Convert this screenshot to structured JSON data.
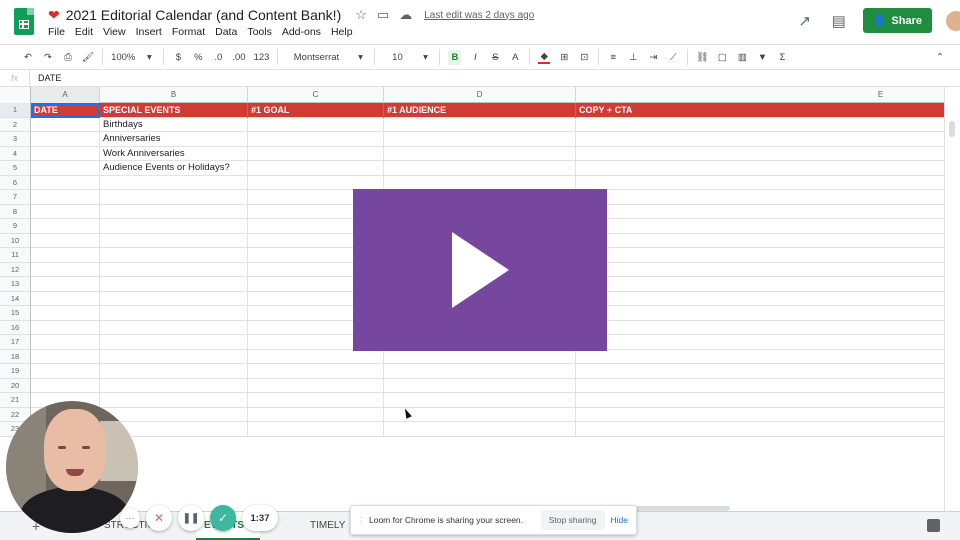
{
  "header": {
    "title": "2021 Editorial Calendar (and Content Bank!)",
    "last_edit": "Last edit was 2 days ago",
    "share_label": "Share",
    "icons": [
      "heart-icon",
      "star-icon",
      "folder-icon",
      "cloud-icon",
      "trend-icon",
      "comment-icon"
    ]
  },
  "menu": {
    "items": [
      "File",
      "Edit",
      "View",
      "Insert",
      "Format",
      "Data",
      "Tools",
      "Add-ons",
      "Help"
    ]
  },
  "toolbar": {
    "zoom": "100%",
    "currency": "$",
    "percent": "%",
    "decrease_decimal": ".0",
    "increase_decimal": ".00",
    "format_more": "123",
    "font": "Montserrat",
    "font_size": "10",
    "bold": "B",
    "italic": "I",
    "strike": "S",
    "text_color": "A"
  },
  "formula": {
    "fx": "fx",
    "value": "DATE"
  },
  "grid": {
    "columns": [
      "A",
      "B",
      "C",
      "D",
      "E"
    ],
    "row_numbers": [
      "1",
      "2",
      "3",
      "4",
      "5",
      "6",
      "7",
      "8",
      "9",
      "10",
      "11",
      "12",
      "13",
      "14",
      "15",
      "16",
      "17",
      "18",
      "19",
      "20",
      "21",
      "22",
      "23"
    ],
    "header_row": [
      "DATE",
      "SPECIAL EVENTS",
      "#1 GOAL",
      "#1 AUDIENCE",
      "COPY + CTA"
    ],
    "rows": [
      [
        "",
        "Birthdays",
        "",
        "",
        ""
      ],
      [
        "",
        "Anniversaries",
        "",
        "",
        ""
      ],
      [
        "",
        "Work Anniversaries",
        "",
        "",
        ""
      ],
      [
        "",
        "Audience Events or Holidays?",
        "",
        "",
        ""
      ]
    ]
  },
  "tabs": {
    "items": [
      "STRUCTIO",
      "EVENTS",
      "TIMELY"
    ]
  },
  "loom": {
    "message": "Loom for Chrome is sharing your screen.",
    "stop_label": "Stop sharing",
    "hide_label": "Hide",
    "timer": "1:37"
  },
  "colors": {
    "header_row": "#d23b34",
    "share": "#1e8e3e",
    "video": "#7747a0"
  }
}
